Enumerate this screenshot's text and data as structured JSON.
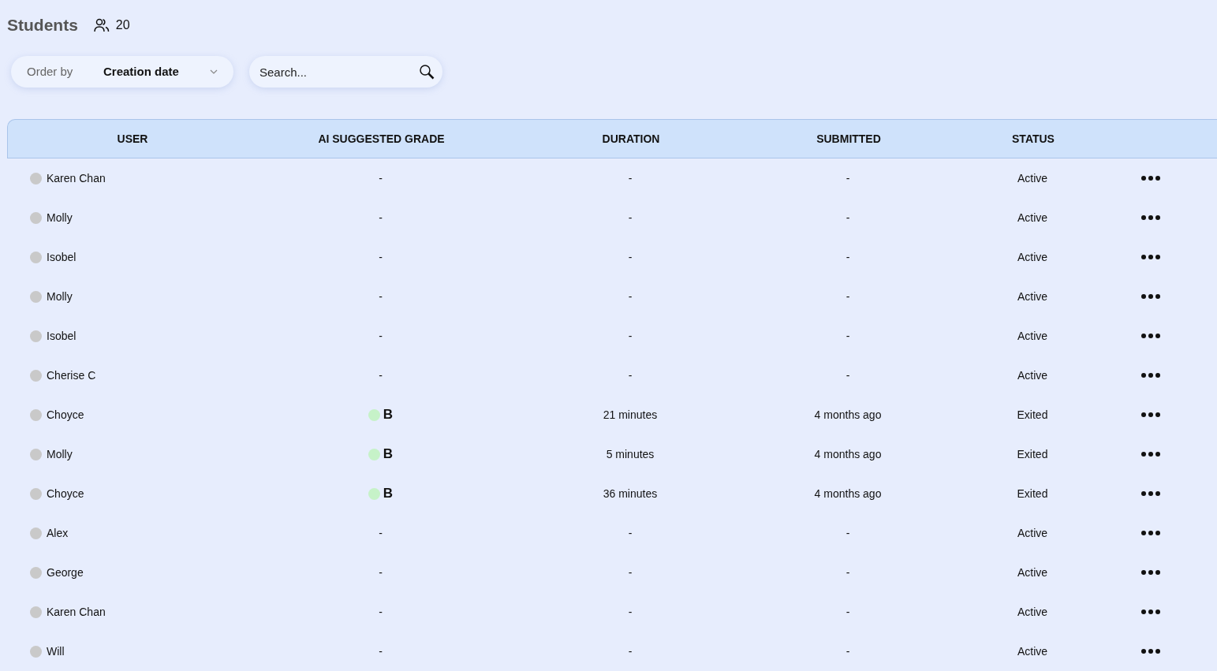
{
  "title": "Students",
  "student_count": "20",
  "order_by": {
    "label": "Order by",
    "value": "Creation date"
  },
  "search": {
    "placeholder": "Search..."
  },
  "table": {
    "columns": [
      "USER",
      "AI SUGGESTED GRADE",
      "DURATION",
      "SUBMITTED",
      "STATUS"
    ],
    "rows": [
      {
        "user": "Karen Chan",
        "grade": {
          "text": "-"
        },
        "duration": "-",
        "submitted": "-",
        "status": "Active"
      },
      {
        "user": "Molly",
        "grade": {
          "text": "-"
        },
        "duration": "-",
        "submitted": "-",
        "status": "Active"
      },
      {
        "user": "Isobel",
        "grade": {
          "text": "-"
        },
        "duration": "-",
        "submitted": "-",
        "status": "Active"
      },
      {
        "user": "Molly",
        "grade": {
          "text": "-"
        },
        "duration": "-",
        "submitted": "-",
        "status": "Active"
      },
      {
        "user": "Isobel",
        "grade": {
          "text": "-"
        },
        "duration": "-",
        "submitted": "-",
        "status": "Active"
      },
      {
        "user": "Cherise C",
        "grade": {
          "text": "-"
        },
        "duration": "-",
        "submitted": "-",
        "status": "Active"
      },
      {
        "user": "Choyce",
        "grade": {
          "text": "B",
          "color": "#c6f2c8"
        },
        "duration": "21 minutes",
        "submitted": "4 months ago",
        "status": "Exited"
      },
      {
        "user": "Molly",
        "grade": {
          "text": "B",
          "color": "#c6f2c8"
        },
        "duration": "5 minutes",
        "submitted": "4 months ago",
        "status": "Exited"
      },
      {
        "user": "Choyce",
        "grade": {
          "text": "B",
          "color": "#c6f2c8"
        },
        "duration": "36 minutes",
        "submitted": "4 months ago",
        "status": "Exited"
      },
      {
        "user": "Alex",
        "grade": {
          "text": "-"
        },
        "duration": "-",
        "submitted": "-",
        "status": "Active"
      },
      {
        "user": "George",
        "grade": {
          "text": "-"
        },
        "duration": "-",
        "submitted": "-",
        "status": "Active"
      },
      {
        "user": "Karen Chan",
        "grade": {
          "text": "-"
        },
        "duration": "-",
        "submitted": "-",
        "status": "Active"
      },
      {
        "user": "Will",
        "grade": {
          "text": "-"
        },
        "duration": "-",
        "submitted": "-",
        "status": "Active"
      }
    ]
  }
}
